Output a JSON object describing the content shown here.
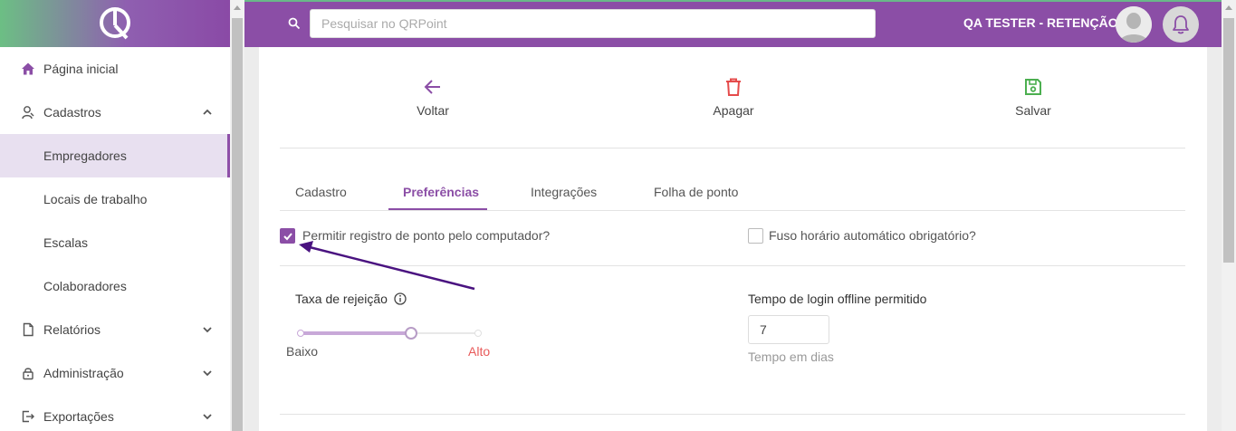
{
  "sidebar": {
    "items": [
      {
        "label": "Página inicial"
      },
      {
        "label": "Cadastros"
      },
      {
        "label": "Empregadores"
      },
      {
        "label": "Locais de trabalho"
      },
      {
        "label": "Escalas"
      },
      {
        "label": "Colaboradores"
      },
      {
        "label": "Relatórios"
      },
      {
        "label": "Administração"
      },
      {
        "label": "Exportações"
      }
    ]
  },
  "header": {
    "search_placeholder": "Pesquisar no QRPoint",
    "user_name": "QA TESTER - RETENÇÃO"
  },
  "toolbar": {
    "back_label": "Voltar",
    "delete_label": "Apagar",
    "save_label": "Salvar"
  },
  "tabs": [
    {
      "label": "Cadastro"
    },
    {
      "label": "Preferências"
    },
    {
      "label": "Integrações"
    },
    {
      "label": "Folha de ponto"
    }
  ],
  "preferences": {
    "allow_computer_label": "Permitir registro de ponto pelo computador?",
    "allow_computer_checked": true,
    "timezone_label": "Fuso horário automático obrigatório?",
    "timezone_checked": false,
    "rejection_label": "Taxa de rejeição",
    "rejection_low": "Baixo",
    "rejection_high": "Alto",
    "rejection_level": 0.62,
    "offline_label": "Tempo de login offline permitido",
    "offline_value": "7",
    "offline_hint": "Tempo em dias"
  },
  "colors": {
    "brand": "#8b4ea6",
    "delete": "#e54b4b",
    "save": "#4caf50",
    "annotation_arrow": "#4a1380"
  }
}
